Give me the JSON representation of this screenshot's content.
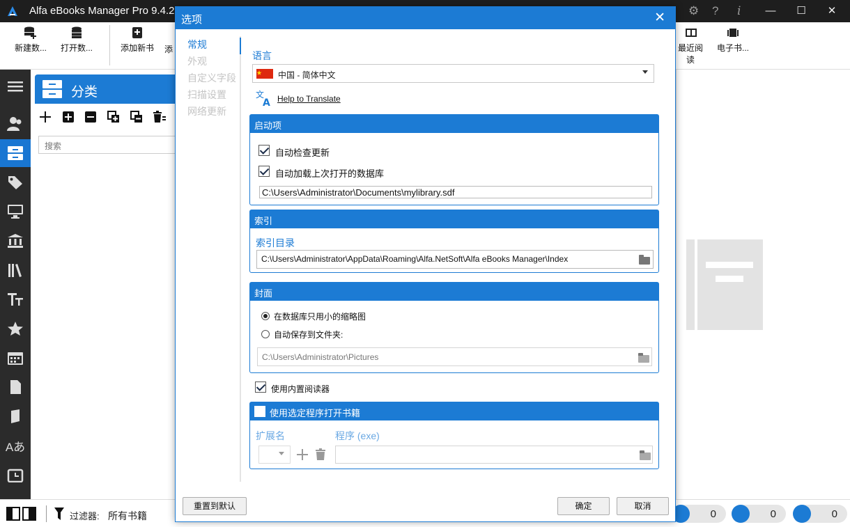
{
  "app": {
    "title": "Alfa eBooks Manager Pro 9.4.2"
  },
  "ribbon": {
    "new_db": "新建数...",
    "open_db": "打开数...",
    "add_book": "添加新书",
    "add_more": "添",
    "recent_read": "最近阅读",
    "ebook": "电子书..."
  },
  "category": {
    "title": "分类",
    "search_placeholder": "搜索"
  },
  "status": {
    "filter_label": "过滤器:",
    "filter_value": "所有书籍",
    "counts": [
      "0",
      "0",
      "0"
    ]
  },
  "dialog": {
    "title": "选项",
    "nav": [
      "常规",
      "外观",
      "自定义字段",
      "扫描设置",
      "网络更新"
    ],
    "language_label": "语言",
    "language_value": "中国 - 简体中文",
    "help_translate": "Help to Translate",
    "startup": {
      "header": "启动项",
      "auto_check_update": "自动检查更新",
      "auto_load_db": "自动加载上次打开的数据库",
      "db_path": "C:\\Users\\Administrator\\Documents\\mylibrary.sdf"
    },
    "index": {
      "header": "索引",
      "dir_label": "索引目录",
      "dir_path": "C:\\Users\\Administrator\\AppData\\Roaming\\Alfa.NetSoft\\Alfa eBooks Manager\\Index"
    },
    "cover": {
      "header": "封面",
      "opt_thumb": "在数据库只用小的缩略图",
      "opt_save": "自动保存到文件夹:",
      "folder_path": "C:\\Users\\Administrator\\Pictures"
    },
    "builtin_reader": "使用内置阅读器",
    "external": {
      "header": "使用选定程序打开书籍",
      "ext_label": "扩展名",
      "prog_label": "程序 (exe)"
    },
    "reset_button": "重置到默认",
    "ok_button": "确定",
    "cancel_button": "取消"
  },
  "colors": {
    "accent": "#1c7bd4",
    "titlebar": "#1e1e1e",
    "nav_bg": "#2b2b2b"
  }
}
